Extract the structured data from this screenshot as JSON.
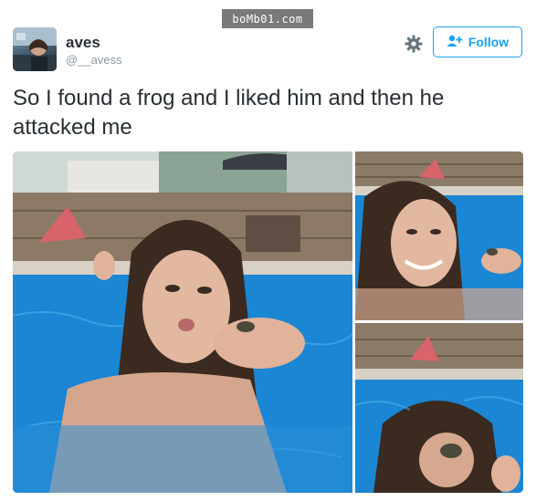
{
  "watermark": "boMb01.com",
  "user": {
    "display_name": "aves",
    "handle": "@__avess",
    "avatar_icon": "profile-photo"
  },
  "actions": {
    "settings_icon": "gear-icon",
    "follow_label": "Follow",
    "follow_icon": "add-user-icon"
  },
  "tweet": {
    "text": "So I found a frog and I liked him and then he attacked me"
  },
  "media": {
    "photos": [
      {
        "description": "girl in pool holding frog"
      },
      {
        "description": "girl smiling holding frog"
      },
      {
        "description": "frog jumping onto girl's face"
      }
    ]
  },
  "colors": {
    "accent": "#1da1f2",
    "text": "#292f33",
    "muted": "#8899a6"
  }
}
